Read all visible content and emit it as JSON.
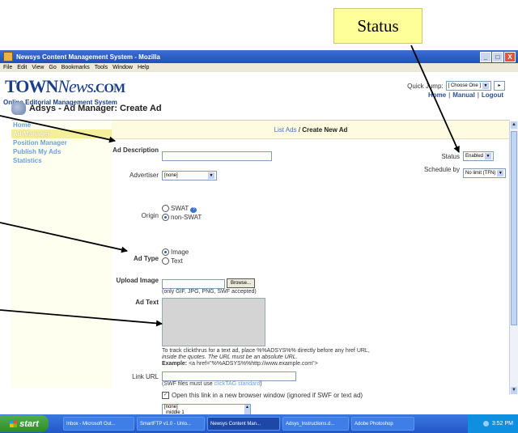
{
  "callout": {
    "label": "Status"
  },
  "window": {
    "title": "Newsys Content Management System - Mozilla",
    "menu": [
      "File",
      "Edit",
      "View",
      "Go",
      "Bookmarks",
      "Tools",
      "Window",
      "Help"
    ],
    "controls": {
      "minimize": "_",
      "maximize": "□",
      "close": "X"
    }
  },
  "header": {
    "logo_main": "TOWN",
    "logo_news": "News",
    "logo_com": ".COM",
    "subtitle": "Online Editorial Management System",
    "quick_jump_label": "Quick Jump:",
    "quick_jump_value": "[ Choose One ]",
    "links": [
      "Home",
      "Manual",
      "Logout"
    ]
  },
  "module": {
    "title": "Adsys - Ad Manager: Create Ad"
  },
  "sidebar": {
    "items": [
      {
        "label": "Home",
        "active": false
      },
      {
        "label": "Ad Manager",
        "active": true
      },
      {
        "label": "Position Manager",
        "active": false
      },
      {
        "label": "Publish My Ads",
        "active": false
      },
      {
        "label": "Statistics",
        "active": false
      }
    ]
  },
  "breadcrumb": {
    "link": "List Ads",
    "separator": " / ",
    "current": "Create New Ad"
  },
  "form": {
    "ad_description_label": "Ad Description",
    "ad_description_value": "",
    "advertiser_label": "Advertiser",
    "advertiser_value": "[none]",
    "origin_label": "Origin",
    "origin_options": [
      "SWAT",
      "non-SWAT"
    ],
    "origin_selected": "non-SWAT",
    "ad_type_label": "Ad Type",
    "ad_type_options": [
      "Image",
      "Text"
    ],
    "ad_type_selected": "Image",
    "upload_label": "Upload Image",
    "browse_label": "Browse...",
    "upload_hint": "(only GIF, JPG, PNG, SWF accepted)",
    "ad_text_label": "Ad Text",
    "help_line1": "To track clickthrus for a text ad, place %%ADSYS%% directly before any href URL,",
    "help_line2": "inside the quotes. The URL must be an absolute URL.",
    "help_example_label": "Example:",
    "help_example": "<a href=\"%%ADSYS%%http://www.example.com\">",
    "link_url_label": "Link URL",
    "link_url_value": "",
    "swf_hint_prefix": "(SWF files must use ",
    "swf_hint_link": "clickTAG standard",
    "swf_hint_suffix": ")",
    "new_window_label": "Open this link in a new browser window (ignored if SWF or text ad)",
    "new_window_checked": true,
    "position_list": [
      "[none]",
      "middle 1"
    ],
    "status_label": "Status",
    "status_value": "Enabled",
    "schedule_label": "Schedule by",
    "schedule_value": "No limit (TFN)"
  },
  "taskbar": {
    "start": "start",
    "tasks": [
      {
        "label": "Inbox - Microsoft Out...",
        "active": false
      },
      {
        "label": "SmartFTP v1.0 - Unlo...",
        "active": false
      },
      {
        "label": "Newsys Content Man...",
        "active": true
      },
      {
        "label": "Adsys_Instructions.d...",
        "active": false
      },
      {
        "label": "Adobe Photoshop",
        "active": false
      }
    ],
    "clock": "3:52 PM"
  }
}
